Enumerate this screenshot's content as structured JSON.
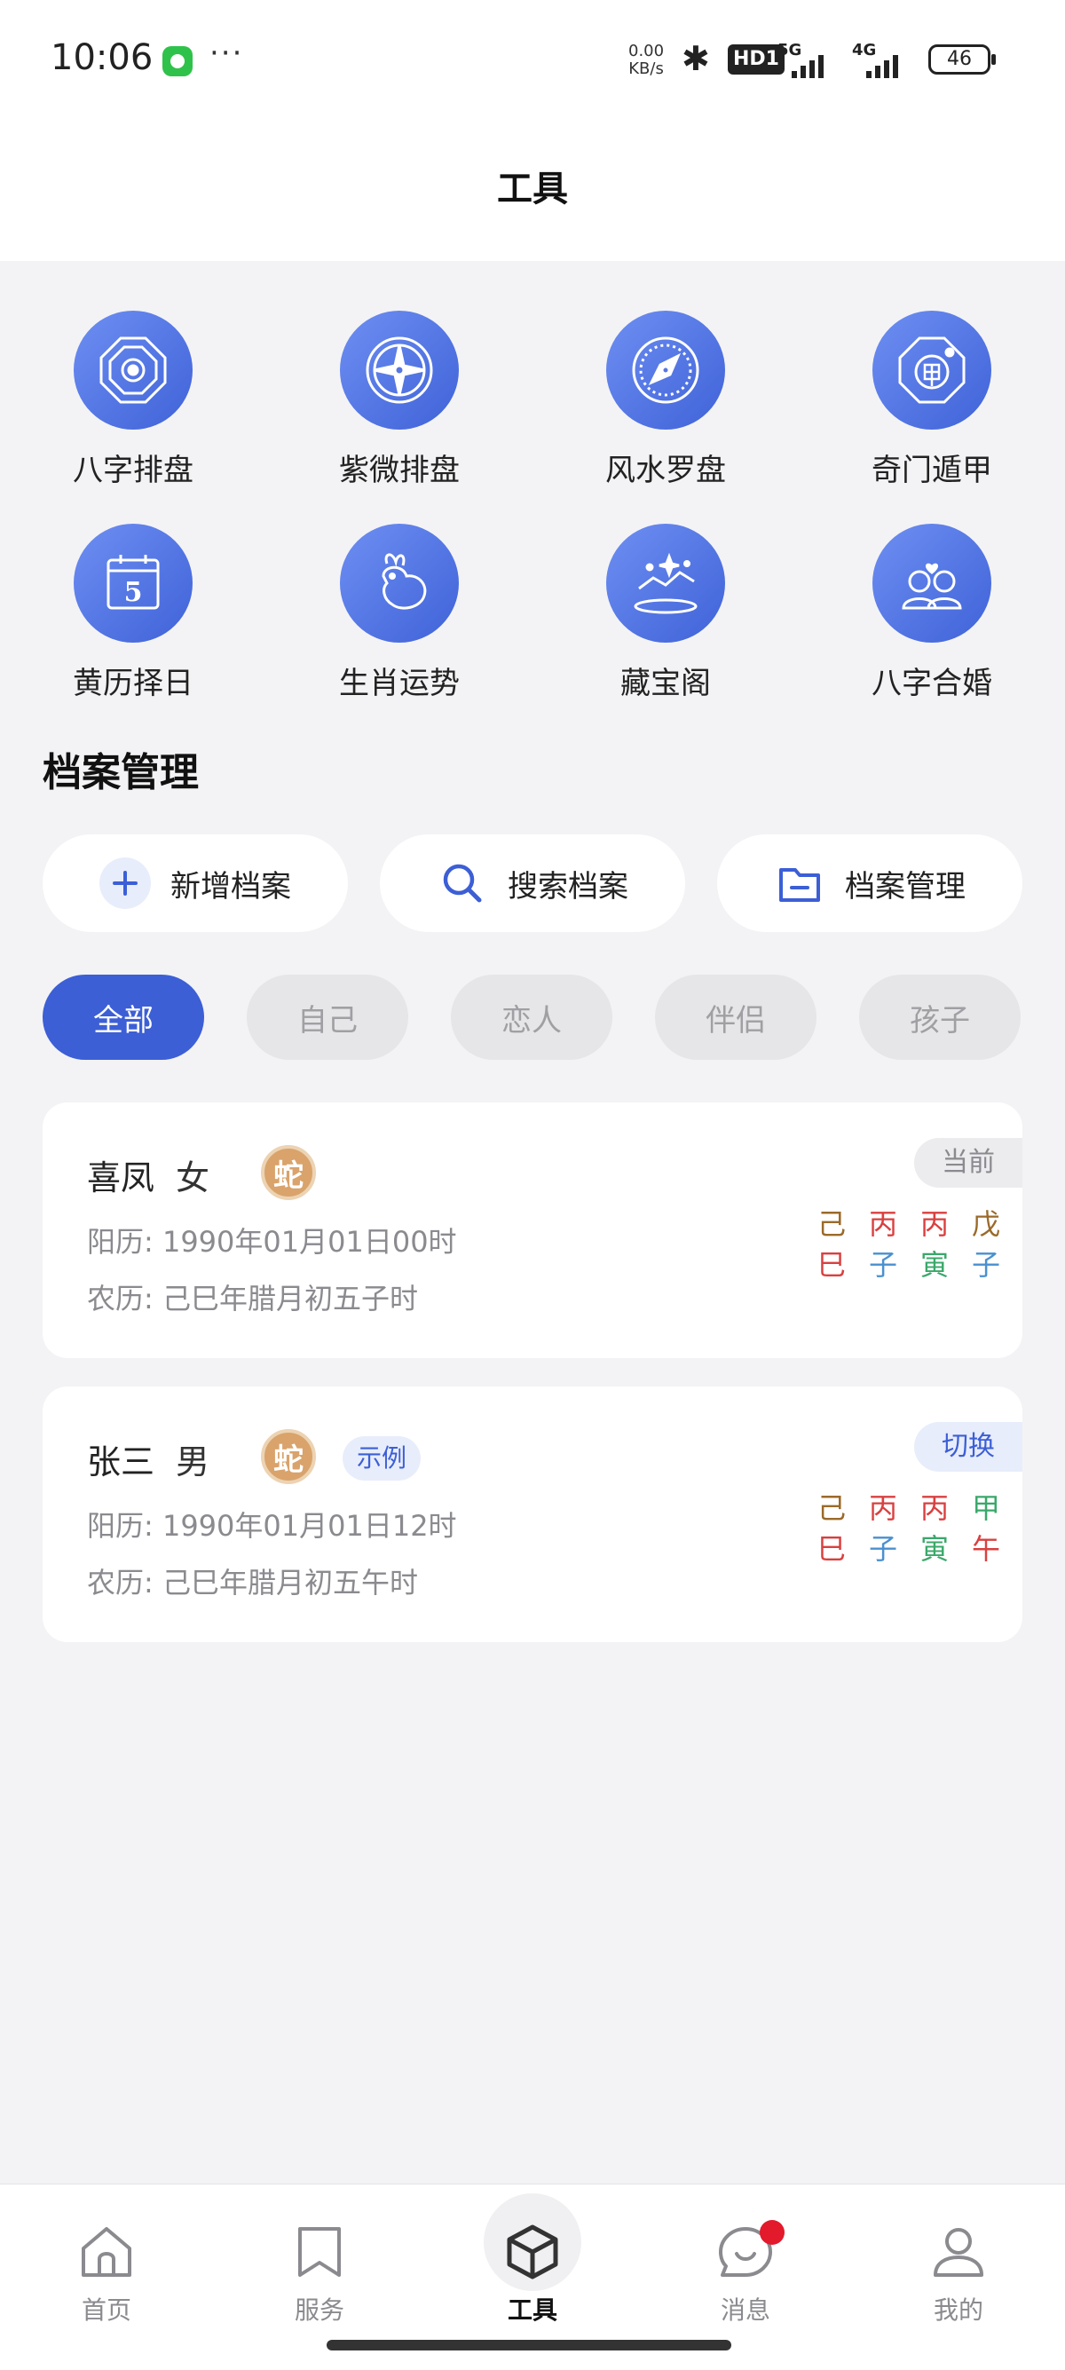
{
  "status_bar": {
    "time": "10:06",
    "dots": "···",
    "net_speed_value": "0.00",
    "net_speed_unit": "KB/s",
    "hd_label": "HD1",
    "signal1_label": "5G",
    "signal2_label": "4G",
    "battery": "46"
  },
  "header": {
    "title": "工具"
  },
  "tools": [
    {
      "label": "八字排盘",
      "icon": "bagua-icon"
    },
    {
      "label": "紫微排盘",
      "icon": "compass-star-icon"
    },
    {
      "label": "风水罗盘",
      "icon": "luopan-icon"
    },
    {
      "label": "奇门遁甲",
      "icon": "qimen-icon"
    },
    {
      "label": "黄历择日",
      "icon": "calendar-icon",
      "calendar_number": "5"
    },
    {
      "label": "生肖运势",
      "icon": "zodiac-rabbit-icon"
    },
    {
      "label": "藏宝阁",
      "icon": "treasure-icon"
    },
    {
      "label": "八字合婚",
      "icon": "couple-icon"
    }
  ],
  "archive": {
    "title": "档案管理",
    "actions": [
      {
        "label": "新增档案",
        "icon": "plus-icon"
      },
      {
        "label": "搜索档案",
        "icon": "search-icon"
      },
      {
        "label": "档案管理",
        "icon": "folder-icon"
      }
    ],
    "filters": [
      "全部",
      "自己",
      "恋人",
      "伴侣",
      "孩子"
    ],
    "active_filter": 0
  },
  "profiles": [
    {
      "name": "喜凤",
      "gender": "女",
      "zodiac": "蛇",
      "badge": "",
      "tag": "当前",
      "solar": "阳历: 1990年01月01日00时",
      "lunar": "农历: 己巳年腊月初五子时",
      "bazi_top": [
        "己",
        "丙",
        "丙",
        "戊"
      ],
      "bazi_bottom": [
        "巳",
        "子",
        "寅",
        "子"
      ]
    },
    {
      "name": "张三",
      "gender": "男",
      "zodiac": "蛇",
      "badge": "示例",
      "tag": "切换",
      "solar": "阳历: 1990年01月01日12时",
      "lunar": "农历: 己巳年腊月初五午时",
      "bazi_top": [
        "己",
        "丙",
        "丙",
        "甲"
      ],
      "bazi_bottom": [
        "巳",
        "子",
        "寅",
        "午"
      ]
    }
  ],
  "colors": {
    "accent": "#3c5fd6",
    "earth": "#9a6a2a",
    "fire": "#d94040",
    "water": "#4a90d0",
    "wood": "#3aa86a"
  },
  "bottom_nav": [
    {
      "label": "首页",
      "icon": "home-icon"
    },
    {
      "label": "服务",
      "icon": "bookmark-icon"
    },
    {
      "label": "工具",
      "icon": "cube-icon"
    },
    {
      "label": "消息",
      "icon": "chat-icon"
    },
    {
      "label": "我的",
      "icon": "user-icon"
    }
  ]
}
